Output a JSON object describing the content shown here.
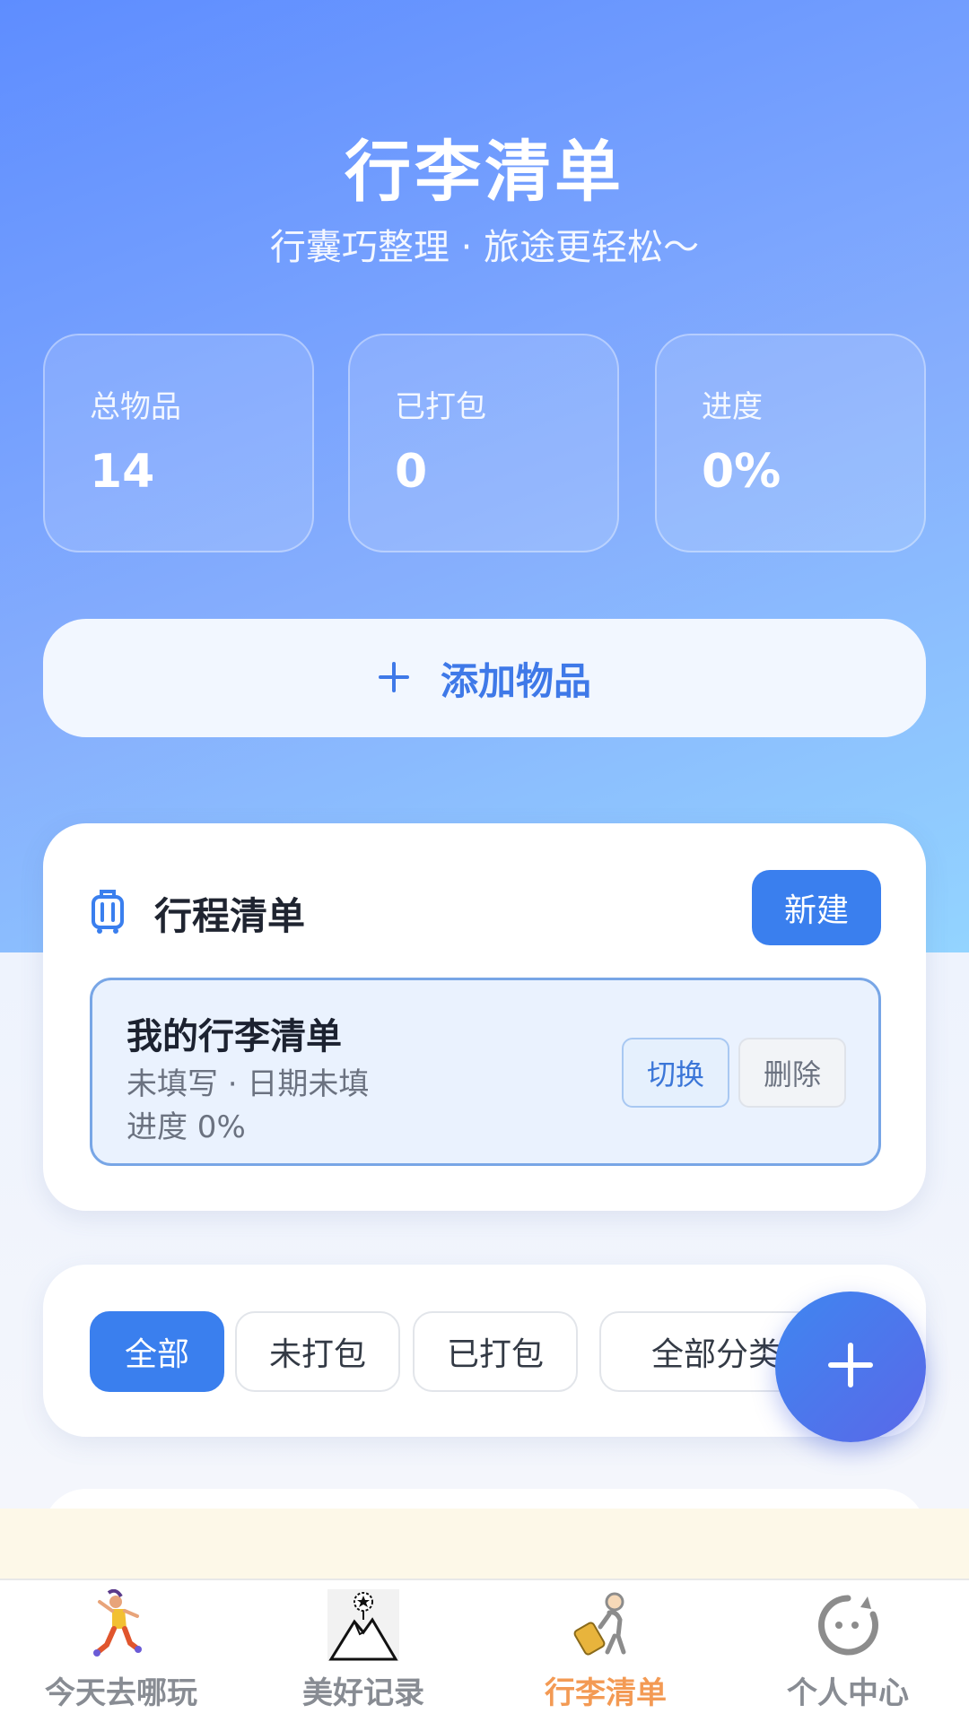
{
  "header": {
    "title": "行李清单",
    "subtitle": "行囊巧整理 · 旅途更轻松～"
  },
  "stats": [
    {
      "label": "总物品",
      "value": "14"
    },
    {
      "label": "已打包",
      "value": "0"
    },
    {
      "label": "进度",
      "value": "0%"
    }
  ],
  "add_item": {
    "icon": "plus-icon",
    "label": "添加物品"
  },
  "trip_card": {
    "icon": "luggage-icon",
    "title": "行程清单",
    "new_label": "新建",
    "trip": {
      "name": "我的行李清单",
      "meta": "未填写 · 日期未填",
      "progress": "进度 0%",
      "switch_label": "切换",
      "delete_label": "删除"
    }
  },
  "filters": [
    {
      "label": "全部",
      "active": true
    },
    {
      "label": "未打包",
      "active": false
    },
    {
      "label": "已打包",
      "active": false
    },
    {
      "label": "全部分类",
      "active": false
    }
  ],
  "fab": {
    "icon": "plus-icon"
  },
  "tabbar": [
    {
      "label": "今天去哪玩",
      "icon": "jumping-person-icon",
      "active": false
    },
    {
      "label": "美好记录",
      "icon": "mountain-star-icon",
      "active": false
    },
    {
      "label": "行李清单",
      "icon": "traveler-suitcase-icon",
      "active": true
    },
    {
      "label": "个人中心",
      "icon": "face-icon",
      "active": false
    }
  ],
  "colors": {
    "accent": "#3a7fee",
    "active_tab": "#f39a54",
    "hero_gradient_start": "#5e8dff",
    "hero_gradient_end": "#93d4ff"
  }
}
